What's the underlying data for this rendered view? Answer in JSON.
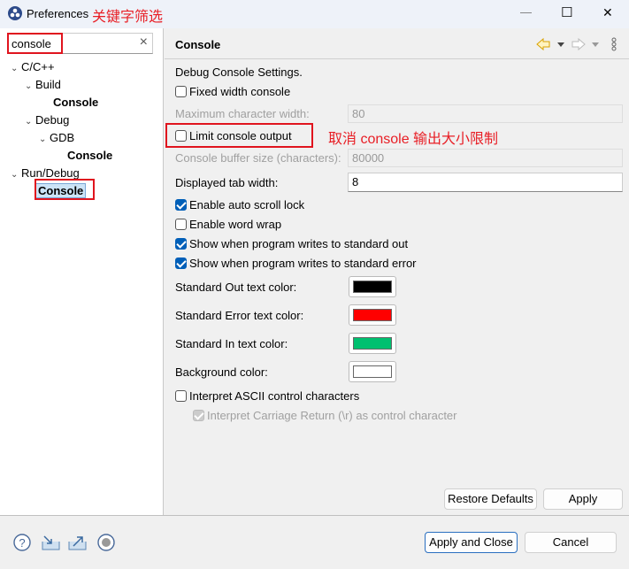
{
  "window": {
    "title": "Preferences",
    "annotation": "关键字筛选",
    "minimize": "—",
    "maximize": "☐",
    "close": "✕"
  },
  "search": {
    "value": "console",
    "clear": "×"
  },
  "tree": [
    {
      "label": "C/C++",
      "level": 0,
      "expanded": true,
      "bold": false
    },
    {
      "label": "Build",
      "level": 1,
      "expanded": true,
      "bold": false
    },
    {
      "label": "Console",
      "level": 2,
      "bold": true
    },
    {
      "label": "Debug",
      "level": 1,
      "expanded": true,
      "bold": false
    },
    {
      "label": "GDB",
      "level": 2,
      "expanded": true,
      "bold": false
    },
    {
      "label": "Console",
      "level": 3,
      "bold": true
    },
    {
      "label": "Run/Debug",
      "level": 0,
      "expanded": true,
      "bold": false
    },
    {
      "label": "Console",
      "level": 1,
      "bold": true,
      "selected": true
    }
  ],
  "page": {
    "title": "Console",
    "section": "Debug Console Settings.",
    "fixed_width": {
      "label": "Fixed width console",
      "checked": false
    },
    "max_width": {
      "label": "Maximum character width:",
      "value": "80"
    },
    "limit_output": {
      "label": "Limit console output",
      "checked": false
    },
    "limit_annotation": "取消 console 输出大小限制",
    "buffer_size": {
      "label": "Console buffer size (characters):",
      "value": "80000"
    },
    "tab_width": {
      "label": "Displayed tab width:",
      "value": "8"
    },
    "auto_scroll": {
      "label": "Enable auto scroll lock",
      "checked": true
    },
    "word_wrap": {
      "label": "Enable word wrap",
      "checked": false
    },
    "show_out": {
      "label": "Show when program writes to standard out",
      "checked": true
    },
    "show_err": {
      "label": "Show when program writes to standard error",
      "checked": true
    },
    "colors": [
      {
        "label": "Standard Out text color:",
        "color": "#000000"
      },
      {
        "label": "Standard Error text color:",
        "color": "#ff0000"
      },
      {
        "label": "Standard In text color:",
        "color": "#00c070"
      },
      {
        "label": "Background color:",
        "color": "#ffffff"
      }
    ],
    "ascii": {
      "label": "Interpret ASCII control characters",
      "checked": false
    },
    "carriage": {
      "label": "Interpret Carriage Return (\\r) as control character",
      "checked": true,
      "disabled": true
    },
    "restore_defaults": "Restore Defaults",
    "apply": "Apply"
  },
  "footer": {
    "apply_close": "Apply and Close",
    "cancel": "Cancel"
  }
}
